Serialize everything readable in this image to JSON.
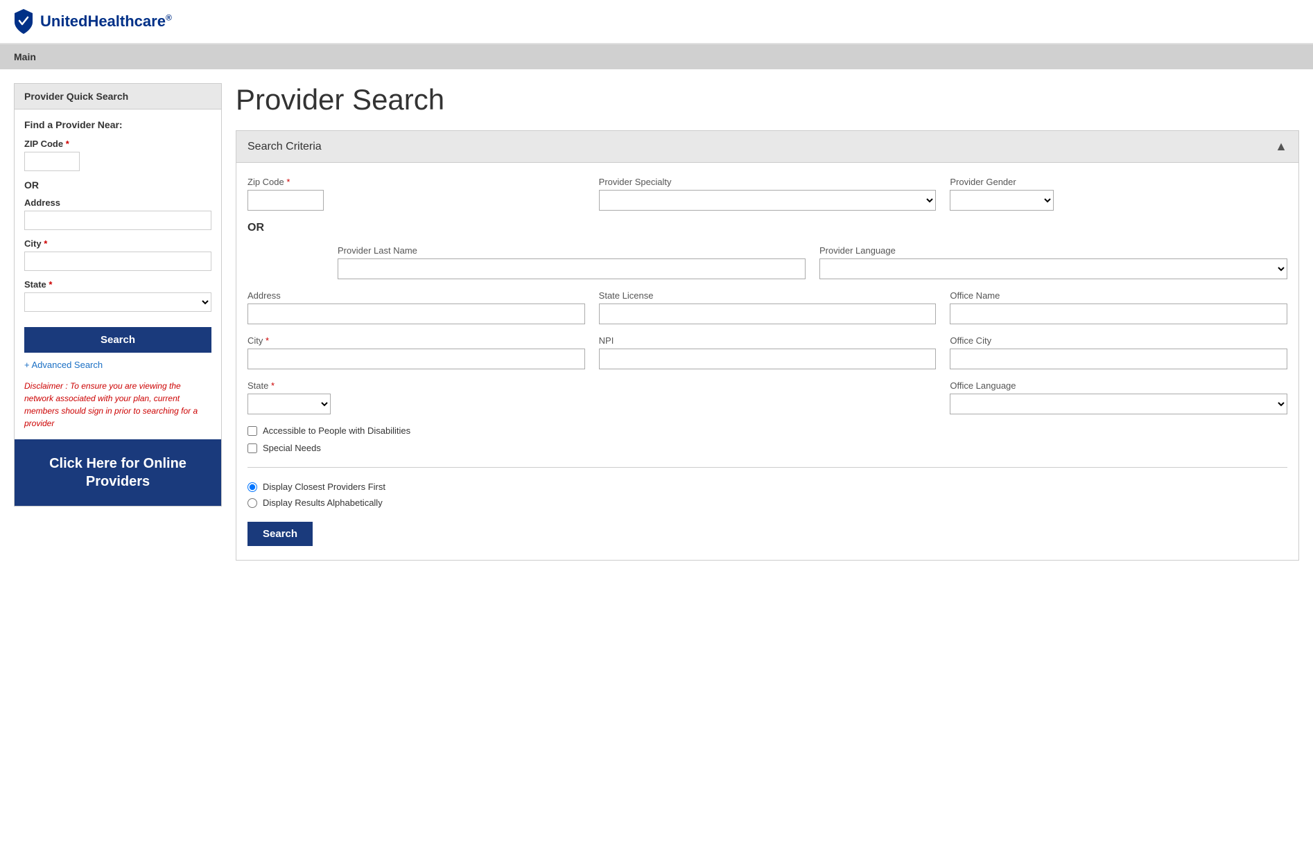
{
  "header": {
    "logo_text": "UnitedHealthcare",
    "logo_reg": "®"
  },
  "nav": {
    "main_link": "Main"
  },
  "sidebar": {
    "title": "Provider Quick Search",
    "find_label": "Find a Provider Near:",
    "zip_label": "ZIP Code",
    "or_text": "OR",
    "address_label": "Address",
    "city_label": "City",
    "state_label": "State",
    "search_btn": "Search",
    "advanced_search": "+ Advanced Search",
    "disclaimer": "Disclaimer : To ensure you are viewing the network associated with your plan, current members should sign in prior to searching for a provider",
    "online_providers_btn": "Click Here for Online Providers"
  },
  "search_area": {
    "page_title": "Provider Search",
    "criteria_section_title": "Search Criteria",
    "collapse_icon": "▲",
    "fields": {
      "zip_code_label": "Zip Code",
      "provider_specialty_label": "Provider Specialty",
      "provider_gender_label": "Provider Gender",
      "or_label": "OR",
      "provider_last_name_label": "Provider Last Name",
      "provider_language_label": "Provider Language",
      "address_label": "Address",
      "state_license_label": "State License",
      "office_name_label": "Office Name",
      "city_label": "City",
      "npi_label": "NPI",
      "office_city_label": "Office City",
      "state_label": "State",
      "office_language_label": "Office Language",
      "accessible_label": "Accessible to People with Disabilities",
      "special_needs_label": "Special Needs"
    },
    "sort_options": {
      "option1": "Display Closest Providers First",
      "option2": "Display Results Alphabetically"
    },
    "search_btn": "Search"
  }
}
